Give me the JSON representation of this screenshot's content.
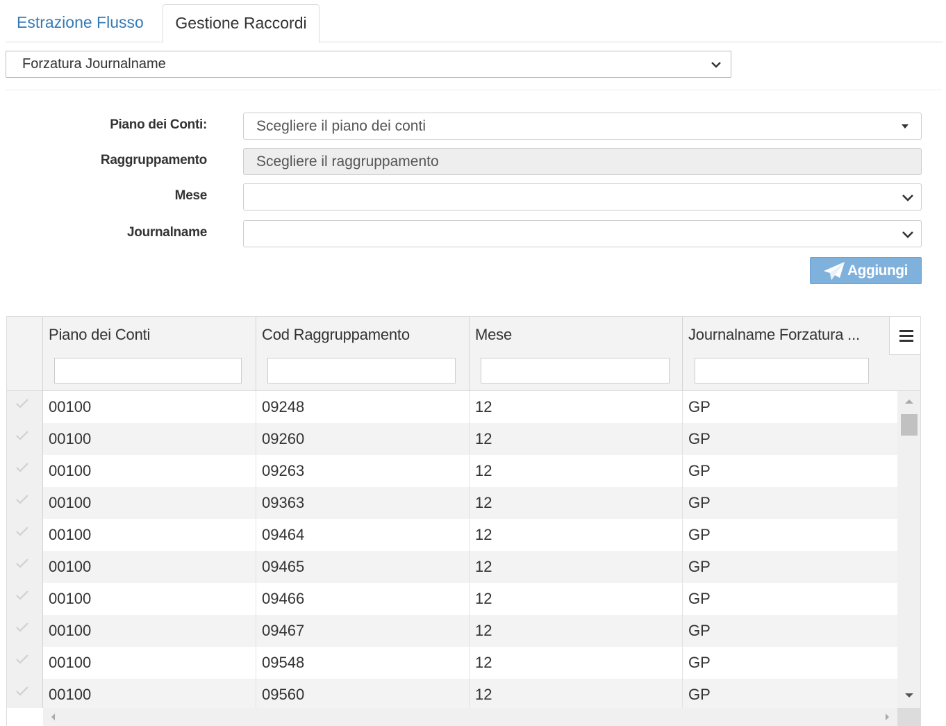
{
  "tabs": [
    {
      "label": "Estrazione Flusso",
      "active": false
    },
    {
      "label": "Gestione Raccordi",
      "active": true
    }
  ],
  "top_select": {
    "value": "Forzatura Journalname"
  },
  "form": {
    "piano_label": "Piano dei Conti:",
    "piano_placeholder": "Scegliere il piano dei conti",
    "raggruppamento_label": "Raggruppamento",
    "raggruppamento_placeholder": "Scegliere il raggruppamento",
    "mese_label": "Mese",
    "mese_value": "",
    "journalname_label": "Journalname",
    "journalname_value": ""
  },
  "add_button": {
    "label": "Aggiungi",
    "color": "#7fb1dd"
  },
  "grid": {
    "columns": [
      "Piano dei Conti",
      "Cod Raggruppamento",
      "Mese",
      "Journalname Forzatura ..."
    ],
    "rows": [
      [
        "00100",
        "09248",
        "12",
        "GP"
      ],
      [
        "00100",
        "09260",
        "12",
        "GP"
      ],
      [
        "00100",
        "09263",
        "12",
        "GP"
      ],
      [
        "00100",
        "09363",
        "12",
        "GP"
      ],
      [
        "00100",
        "09464",
        "12",
        "GP"
      ],
      [
        "00100",
        "09465",
        "12",
        "GP"
      ],
      [
        "00100",
        "09466",
        "12",
        "GP"
      ],
      [
        "00100",
        "09467",
        "12",
        "GP"
      ],
      [
        "00100",
        "09548",
        "12",
        "GP"
      ],
      [
        "00100",
        "09560",
        "12",
        "GP"
      ]
    ]
  },
  "colors": {
    "link": "#337ab7",
    "row_alt": "#f3f3f3"
  }
}
